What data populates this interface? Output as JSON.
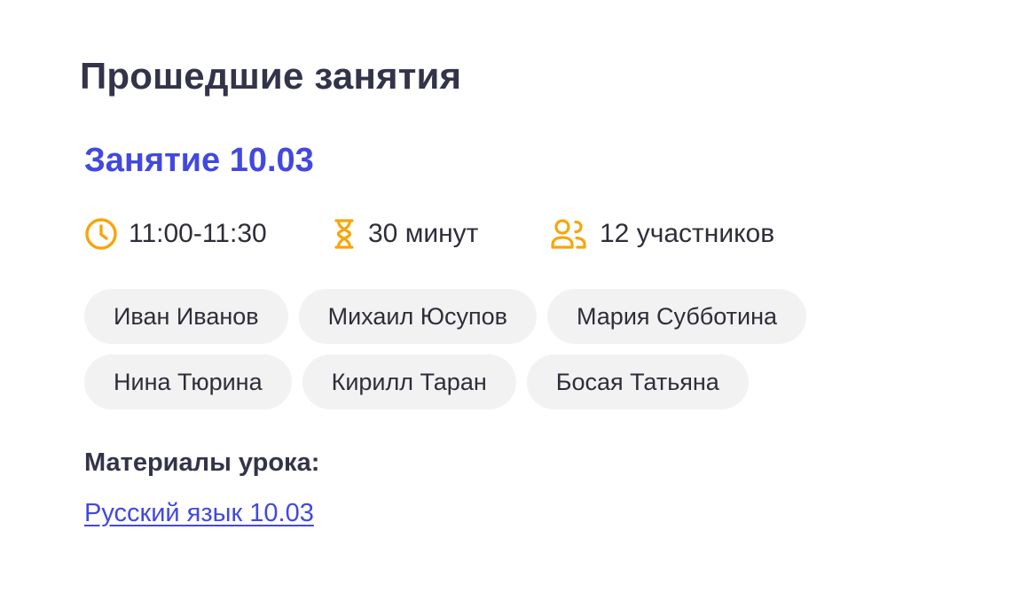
{
  "section": {
    "title": "Прошедшие занятия"
  },
  "lesson": {
    "title": "Занятие 10.03",
    "time": "11:00-11:30",
    "duration": "30 минут",
    "participants_count": "12 участников",
    "participants": [
      [
        "Иван Иванов",
        "Михаил Юсупов",
        "Мария Субботина"
      ],
      [
        "Нина Тюрина",
        "Кирилл Таран",
        "Босая Татьяна"
      ]
    ],
    "materials_label": "Материалы урока:",
    "materials_link": "Русский язык 10.03"
  },
  "icons": {
    "time": "clock-icon",
    "duration": "hourglass-icon",
    "participants": "users-icon"
  },
  "colors": {
    "heading": "#33334a",
    "accent": "#4248e0",
    "icon": "#f6a609",
    "chip_bg": "#f2f2f2"
  }
}
